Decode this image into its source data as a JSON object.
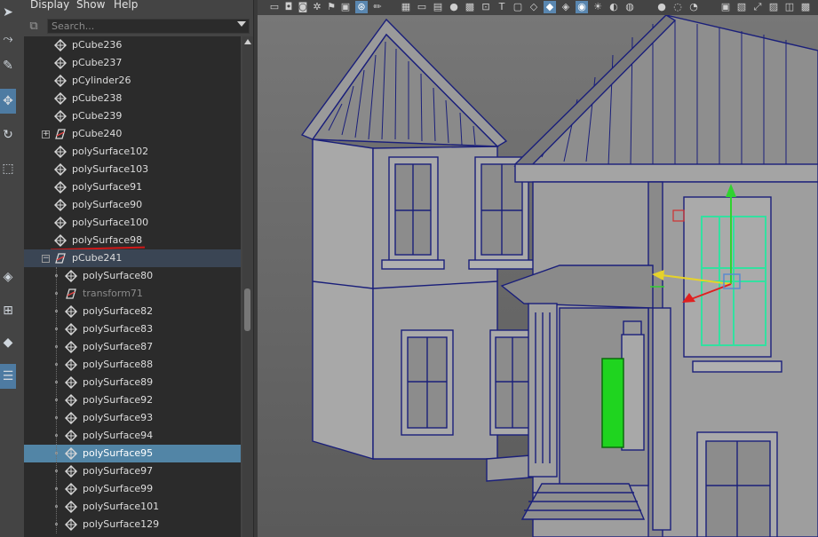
{
  "menubar": {
    "display": "Display",
    "show": "Show",
    "help": "Help"
  },
  "search": {
    "placeholder": "Search..."
  },
  "outliner": {
    "items": [
      {
        "label": "pCube236",
        "icon": "mesh-icon",
        "level": 0
      },
      {
        "label": "pCube237",
        "icon": "mesh-icon",
        "level": 0
      },
      {
        "label": "pCylinder26",
        "icon": "mesh-icon",
        "level": 0
      },
      {
        "label": "pCube238",
        "icon": "mesh-icon",
        "level": 0
      },
      {
        "label": "pCube239",
        "icon": "mesh-icon",
        "level": 0
      },
      {
        "label": "pCube240",
        "icon": "transform-icon",
        "level": 0,
        "expand": "+"
      },
      {
        "label": "polySurface102",
        "icon": "mesh-icon",
        "level": 0
      },
      {
        "label": "polySurface103",
        "icon": "mesh-icon",
        "level": 0
      },
      {
        "label": "polySurface91",
        "icon": "mesh-icon",
        "level": 0
      },
      {
        "label": "polySurface90",
        "icon": "mesh-icon",
        "level": 0
      },
      {
        "label": "polySurface100",
        "icon": "mesh-icon",
        "level": 0
      },
      {
        "label": "polySurface98",
        "icon": "mesh-icon",
        "level": 0
      },
      {
        "label": "pCube241",
        "icon": "transform-icon",
        "level": 0,
        "expand": "−"
      },
      {
        "label": "polySurface80",
        "icon": "mesh-icon",
        "level": 1
      },
      {
        "label": "transform71",
        "icon": "transform-icon",
        "level": 1,
        "dim": true
      },
      {
        "label": "polySurface82",
        "icon": "mesh-icon",
        "level": 1
      },
      {
        "label": "polySurface83",
        "icon": "mesh-icon",
        "level": 1
      },
      {
        "label": "polySurface87",
        "icon": "mesh-icon",
        "level": 1
      },
      {
        "label": "polySurface88",
        "icon": "mesh-icon",
        "level": 1
      },
      {
        "label": "polySurface89",
        "icon": "mesh-icon",
        "level": 1
      },
      {
        "label": "polySurface92",
        "icon": "mesh-icon",
        "level": 1
      },
      {
        "label": "polySurface93",
        "icon": "mesh-icon",
        "level": 1
      },
      {
        "label": "polySurface94",
        "icon": "mesh-icon",
        "level": 1
      },
      {
        "label": "polySurface95",
        "icon": "mesh-icon",
        "level": 1,
        "selected": true
      },
      {
        "label": "polySurface97",
        "icon": "mesh-icon",
        "level": 1
      },
      {
        "label": "polySurface99",
        "icon": "mesh-icon",
        "level": 1
      },
      {
        "label": "polySurface101",
        "icon": "mesh-icon",
        "level": 1
      },
      {
        "label": "polySurface129",
        "icon": "mesh-icon",
        "level": 1
      }
    ]
  },
  "colors": {
    "selection": "#5285a6",
    "wireframe": "#1a1f7a",
    "highlight": "#33e0a0",
    "selectedMesh": "#22cc22"
  }
}
